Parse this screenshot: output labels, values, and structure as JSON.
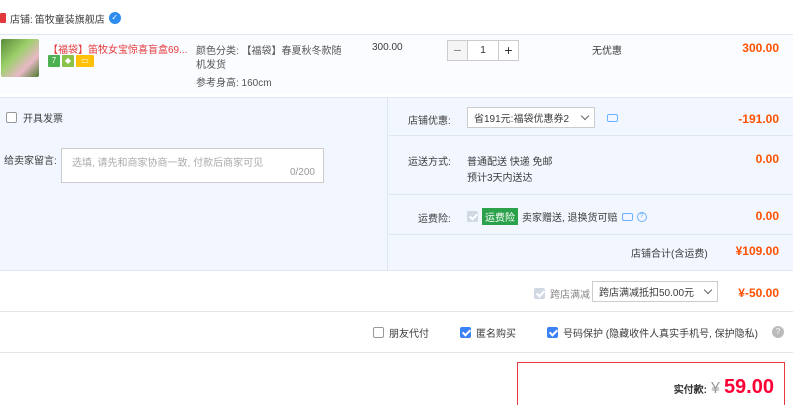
{
  "shop": {
    "prefix": "店铺:",
    "name": "笛牧童装旗舰店"
  },
  "item": {
    "title": "【福袋】笛牧女宝惊喜盲盒69...",
    "badges": [
      "7",
      "◆",
      "▭"
    ],
    "spec_line1": "颜色分类: 【福袋】春夏秋冬款随",
    "spec_line2": "机发货",
    "spec_line3": "参考身高: 160cm",
    "price": "300.00",
    "quantity": "1",
    "minus": "−",
    "plus": "+",
    "discount": "无优惠",
    "subtotal": "300.00"
  },
  "invoice": {
    "label": "开具发票"
  },
  "message": {
    "label": "给卖家留言:",
    "placeholder": "选填, 请先和商家协商一致, 付款后商家可见",
    "count": "0/200"
  },
  "coupon": {
    "label": "店铺优惠:",
    "selected": "省191元:福袋优惠券2",
    "amount": "-191.00"
  },
  "shipping": {
    "label": "运送方式:",
    "method": "普通配送 快递 免邮",
    "eta": "预计3天内送达",
    "amount": "0.00"
  },
  "insurance": {
    "label": "运费险:",
    "tag": "运费险",
    "desc": "卖家赠送, 退换货可赔",
    "amount": "0.00"
  },
  "shop_total": {
    "label": "店铺合计(含运费)",
    "amount": "¥109.00"
  },
  "cross_store": {
    "label": "跨店满减",
    "selected": "跨店满减抵扣50.00元",
    "amount": "¥-50.00"
  },
  "options": {
    "friend_pay": "朋友代付",
    "anonymous": "匿名购买",
    "number_protect": "号码保护 (隐藏收件人真实手机号, 保护隐私)",
    "help": "?"
  },
  "payment": {
    "label": "实付款:",
    "currency": "¥",
    "amount": "59.00"
  },
  "colors": {
    "accent": "#ff5000",
    "panel_bg": "#f2f7ff",
    "check_blue": "#3b82f6"
  }
}
